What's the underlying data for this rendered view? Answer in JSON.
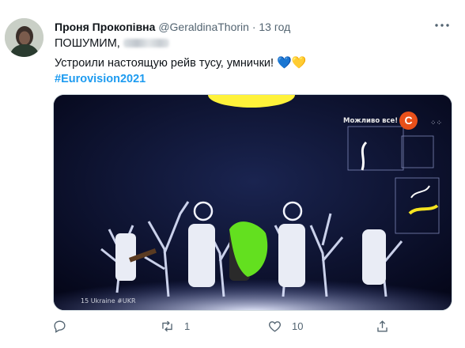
{
  "tweet": {
    "author_name": "Проня Прокопівна",
    "author_handle": "@GeraldinaThorin",
    "separator": "·",
    "time": "13 год",
    "line1": "ПОШУМИМ,",
    "line2": "Устроили настоящую рейв тусу, умнички!",
    "hearts": "💙💛",
    "hashtag": "#Eurovision2021",
    "more_icon": "more-horizontal-icon"
  },
  "media": {
    "overlay_slogan": "Можливо все!",
    "channel_logo": "С",
    "caption": "15 Ukraine #UKR"
  },
  "actions": {
    "reply_count": "",
    "retweet_count": "1",
    "like_count": "10",
    "share_count": ""
  },
  "colors": {
    "link": "#1d9bf0",
    "muted": "#536471",
    "text": "#0f1419"
  }
}
